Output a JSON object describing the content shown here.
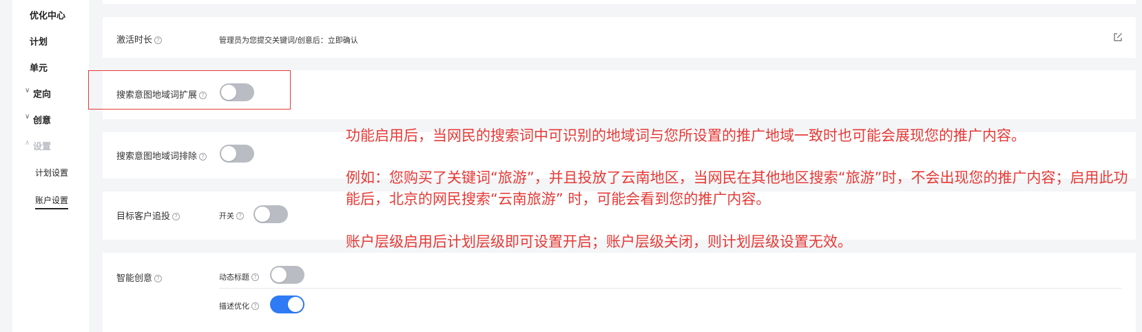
{
  "sidebar": {
    "items": [
      {
        "label": "优化中心"
      },
      {
        "label": "计划"
      },
      {
        "label": "单元"
      },
      {
        "label": "定向"
      },
      {
        "label": "创意"
      },
      {
        "label": "设置"
      }
    ],
    "subitems": [
      {
        "label": "计划设置"
      },
      {
        "label": "账户设置"
      }
    ]
  },
  "rows": {
    "activation": {
      "label": "激活时长",
      "value": "管理员为您提交关键词/创意后：立即确认"
    },
    "geo_expand": {
      "label": "搜索意图地域词扩展",
      "enabled": false
    },
    "geo_exclude": {
      "label": "搜索意图地域词排除",
      "enabled": false
    },
    "target_retarget": {
      "label": "目标客户追投",
      "switch_label": "开关",
      "enabled": false
    },
    "smart_creative": {
      "label": "智能创意",
      "options": [
        {
          "label": "动态标题",
          "enabled": false
        },
        {
          "label": "描述优化",
          "enabled": true
        }
      ]
    }
  },
  "annotation": {
    "line1": "功能启用后，当网民的搜索词中可识别的地域词与您所设置的推广地域一致时也可能会展现您的推广内容。",
    "line2": "例如：您购买了关键词“旅游”，并且投放了云南地区，当网民在其他地区搜索“旅游”时，不会出现您的推广内容；启用此功能后，北京的网民搜索“云南旅游” 时，可能会看到您的推广内容。",
    "line3": "账户层级启用后计划层级即可设置开启；账户层级关闭，则计划层级设置无效。"
  },
  "colors": {
    "accent": "#2f7bf5",
    "annotation_red": "#e53935",
    "toggle_off": "#b9bcc2"
  },
  "icons": {
    "help": "question-circle-icon",
    "edit": "edit-icon",
    "expand": "chevron-down-icon",
    "collapse": "chevron-up-icon"
  }
}
